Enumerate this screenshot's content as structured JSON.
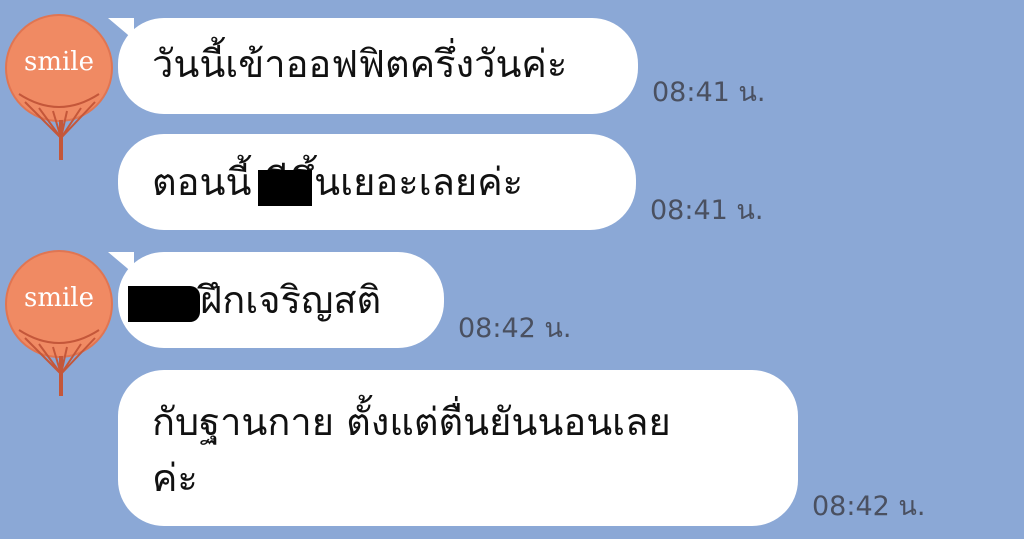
{
  "chat": {
    "avatar_text": "smile",
    "messages": [
      {
        "text": "วันนี้เข้าออฟฟิตครึ่งวันค่ะ",
        "time": "08:41 น."
      },
      {
        "text": "ตอนนี้ ดีขึ้นเยอะเลยค่ะ",
        "time": "08:41 น."
      },
      {
        "text": "ฝึกเจริญสติ",
        "time": "08:42 น."
      },
      {
        "line1": "กับฐานกาย ตั้งแต่ตื่นยันนอนเลย",
        "line2": "ค่ะ",
        "time": "08:42 น."
      }
    ]
  },
  "colors": {
    "background": "#8ba8d6",
    "bubble": "#ffffff",
    "avatar_fan": "#f08a63"
  },
  "icons": [
    "smile-fan-avatar"
  ]
}
